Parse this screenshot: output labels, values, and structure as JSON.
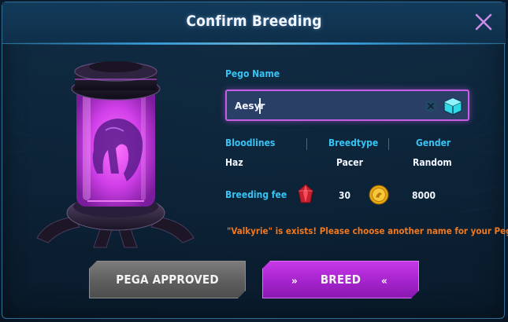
{
  "dialog": {
    "title": "Confirm Breeding",
    "close_icon": "close-icon"
  },
  "name_field": {
    "label": "Pego Name",
    "value": "Aesyr",
    "clear_icon": "clear-x-icon",
    "random_icon": "cube-dice-icon"
  },
  "attributes": {
    "headers": [
      "Bloodlines",
      "Breedtype",
      "Gender"
    ],
    "values": [
      "Haz",
      "Pacer",
      "Random"
    ]
  },
  "fee": {
    "label": "Breeding fee",
    "gem_icon": "red-gem-icon",
    "gem_amount": "30",
    "coin_icon": "gold-coin-icon",
    "coin_amount": "8000"
  },
  "warning": "\"Valkyrie\" is exists! Please choose another name for your Pego!",
  "buttons": {
    "approved": "PEGA APPROVED",
    "breed": "BREED"
  },
  "colors": {
    "accent_blue": "#36c3f3",
    "warning_orange": "#f0781e",
    "input_border": "#c85ee8",
    "breed_purple": "#b02ed8",
    "approved_gray": "#6a6a6a"
  },
  "images": {
    "capsule": "purple-pega-egg-capsule"
  }
}
